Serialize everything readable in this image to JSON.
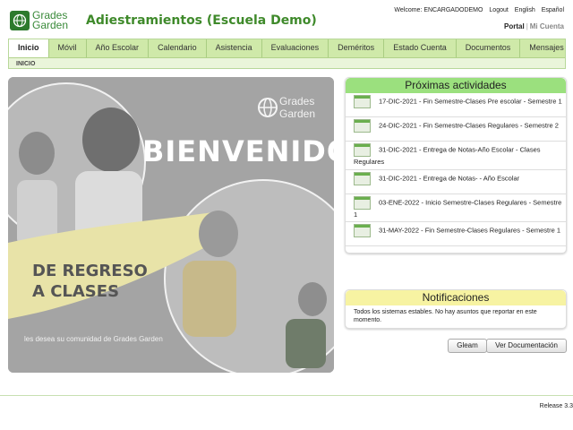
{
  "brand": {
    "logo_line1": "Grades",
    "logo_line2": "Garden",
    "school": "Adiestramientos (Escuela Demo)"
  },
  "toplinks": {
    "user": "Welcome: ENCARGADODEMO",
    "logout": "Logout",
    "english": "English",
    "spanish": "Español"
  },
  "portal": {
    "portal": "Portal",
    "sep": "|",
    "account": "Mi Cuenta"
  },
  "nav": {
    "tabs": [
      "Inicio",
      "Móvil",
      "Año Escolar",
      "Calendario",
      "Asistencia",
      "Evaluaciones",
      "Deméritos",
      "Estado Cuenta",
      "Documentos",
      "Mensajes"
    ],
    "breadcrumb": "INICIO"
  },
  "hero": {
    "logo_line1": "Grades",
    "logo_line2": "Garden",
    "heading": "BIENVENIDOS",
    "banner_line1": "DE REGRESO",
    "banner_line2": "A CLASES",
    "tagline": "les desea su comunidad de Grades Garden"
  },
  "activities": {
    "title": "Próximas actividades",
    "items": [
      "17-DIC-2021 - Fin Semestre-Clases Pre escolar - Semestre 1",
      "24-DIC-2021 - Fin Semestre-Clases Regulares - Semestre 2",
      "31-DIC-2021 - Entrega de Notas-Año Escolar - Clases Regulares",
      "31-DIC-2021 - Entrega de Notas- - Año Escolar",
      "03-ENE-2022 - Inicio Semestre-Clases Regulares - Semestre 1",
      "31-MAY-2022 - Fin Semestre-Clases Regulares - Semestre 1"
    ]
  },
  "notifications": {
    "title": "Notificaciones",
    "body": "Todos los sistemas estables. No hay asuntos que reportar en este momento."
  },
  "buttons": {
    "gleam": "Gleam",
    "docs": "Ver Documentación"
  },
  "footer": {
    "release": "Release 3.3"
  }
}
